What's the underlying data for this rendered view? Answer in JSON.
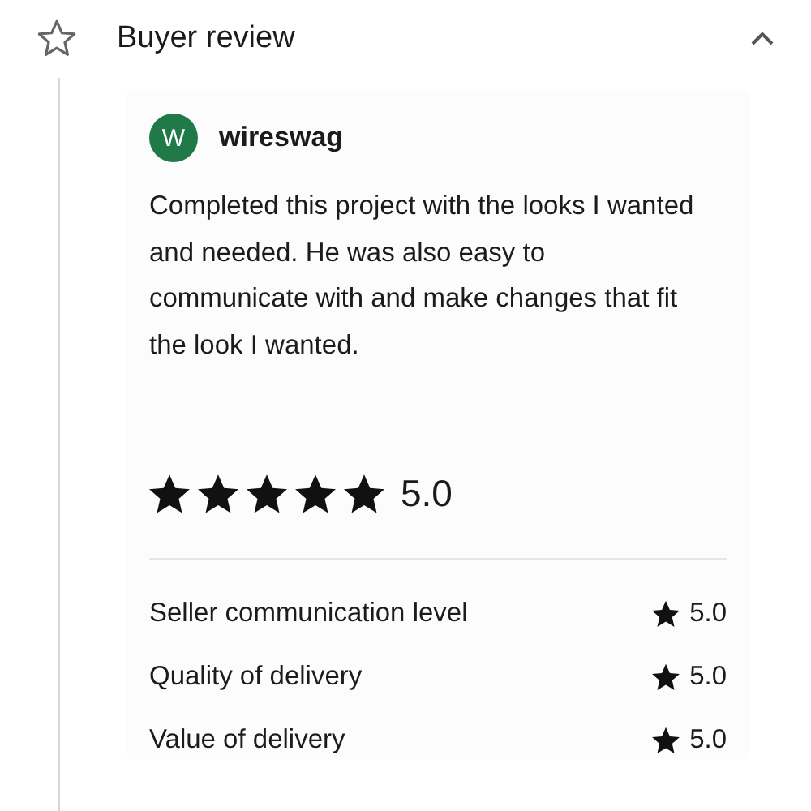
{
  "section": {
    "title": "Buyer review",
    "expanded": true
  },
  "review": {
    "avatar": {
      "letter": "W",
      "color": "#1f7a47"
    },
    "author": "wireswag",
    "text": "Completed this project with the looks I wanted and needed. He was also easy to communicate with and make changes that fit the look I wanted.",
    "stars": 5,
    "score": "5.0"
  },
  "ratings": [
    {
      "label": "Seller communication level",
      "score": "5.0"
    },
    {
      "label": "Quality of delivery",
      "score": "5.0"
    },
    {
      "label": "Value of delivery",
      "score": "5.0"
    }
  ]
}
